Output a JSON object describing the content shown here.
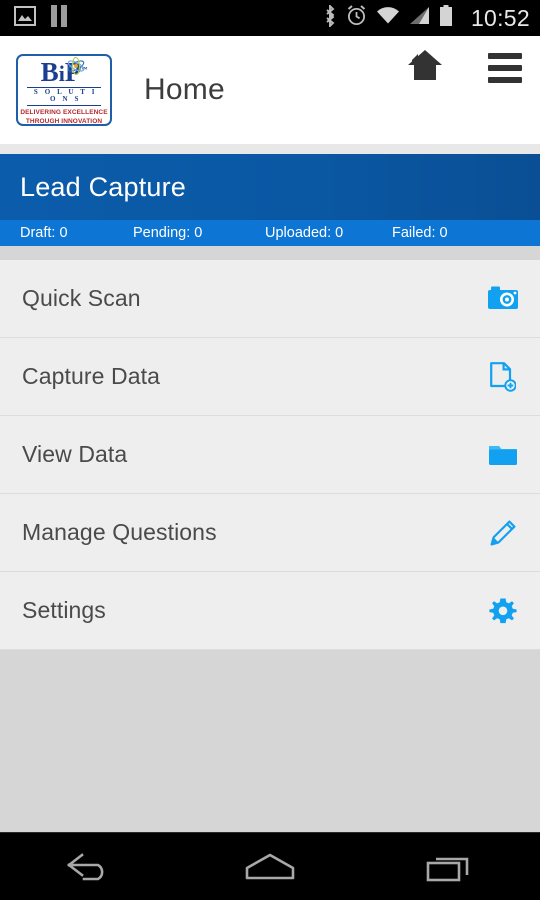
{
  "status_bar": {
    "time": "10:52",
    "left_icons": [
      {
        "name": "gallery-icon",
        "label": "Gallery"
      },
      {
        "name": "pause-icon",
        "label": "Pause"
      }
    ],
    "right_icons": [
      {
        "name": "bluetooth-icon",
        "label": "Bluetooth"
      },
      {
        "name": "alarm-clock-icon",
        "label": "Alarm"
      },
      {
        "name": "wifi-icon",
        "label": "Wi-Fi"
      },
      {
        "name": "cellular-signal-icon",
        "label": "Signal"
      },
      {
        "name": "battery-icon",
        "label": "Battery"
      }
    ]
  },
  "app_bar": {
    "title": "Home",
    "logo": {
      "brand_b": "B",
      "brand_i": "i",
      "brand_p": "P",
      "trademark": "™",
      "subtitle": "S O L U T I O N S",
      "tagline_line1": "DELIVERING EXCELLENCE",
      "tagline_line2": "THROUGH INNOVATION"
    },
    "actions": [
      {
        "name": "home-icon",
        "label": "Home"
      },
      {
        "name": "menu-icon",
        "label": "Menu"
      }
    ]
  },
  "banner": {
    "title": "Lead Capture",
    "stats": [
      {
        "label": "Draft: 0",
        "key": "draft",
        "count": 0
      },
      {
        "label": "Pending: 0",
        "key": "pending",
        "count": 0
      },
      {
        "label": "Uploaded: 0",
        "key": "uploaded",
        "count": 0
      },
      {
        "label": "Failed: 0",
        "key": "failed",
        "count": 0
      }
    ]
  },
  "menu": {
    "items": [
      {
        "label": "Quick Scan",
        "icon": "camera-icon"
      },
      {
        "label": "Capture Data",
        "icon": "document-add-icon"
      },
      {
        "label": "View Data",
        "icon": "folder-icon"
      },
      {
        "label": "Manage Questions",
        "icon": "pencil-icon"
      },
      {
        "label": "Settings",
        "icon": "gear-icon"
      }
    ]
  },
  "nav_bar": {
    "buttons": [
      {
        "name": "back-button",
        "label": "Back"
      },
      {
        "name": "home-button",
        "label": "Home"
      },
      {
        "name": "recents-button",
        "label": "Recent apps"
      }
    ]
  },
  "colors": {
    "accent_blue": "#0d9ef5",
    "banner_blue": "#0b5cab",
    "stats_blue": "#0d75d4",
    "list_bg": "#eeeeee",
    "page_bg": "#d6d6d6",
    "logo_blue": "#1a3f8f",
    "logo_red": "#b4272c"
  }
}
